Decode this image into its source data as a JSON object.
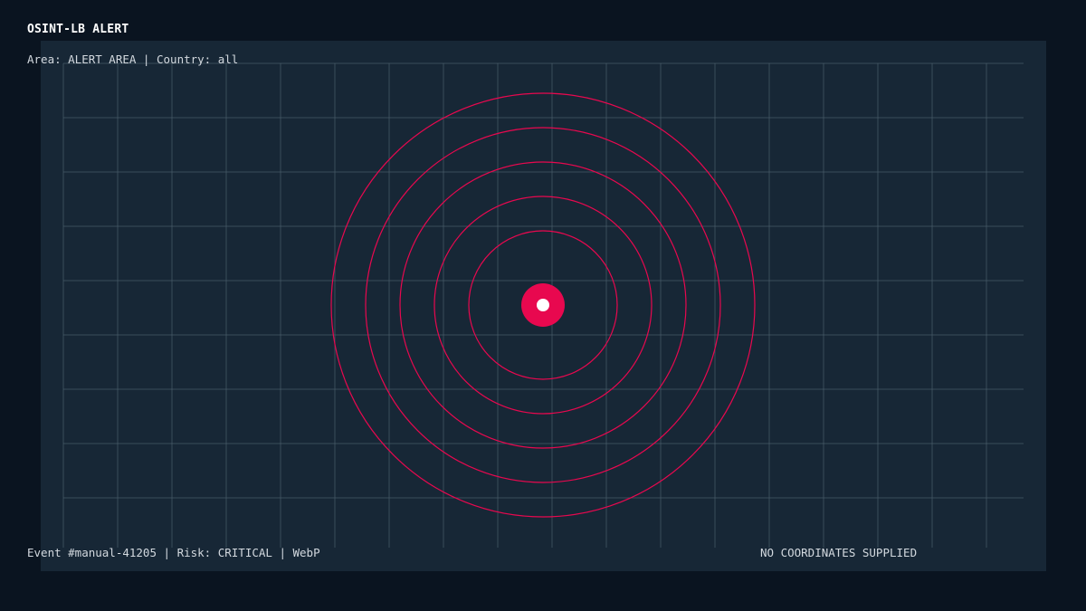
{
  "header": {
    "title": "OSINT-LB ALERT",
    "subtitle": "Area: ALERT AREA | Country: all"
  },
  "footer": {
    "event_info": "Event #manual-41205 | Risk: CRITICAL | WebP",
    "coordinates_status": "NO COORDINATES SUPPLIED"
  },
  "map": {
    "marker_icon": "alert-target-icon",
    "ring_count": 5,
    "colors": {
      "background": "#0a1420",
      "panel": "#172736",
      "grid": "#4a5d6c",
      "alert": "#e8084f",
      "marker_core": "#ffffff"
    }
  }
}
